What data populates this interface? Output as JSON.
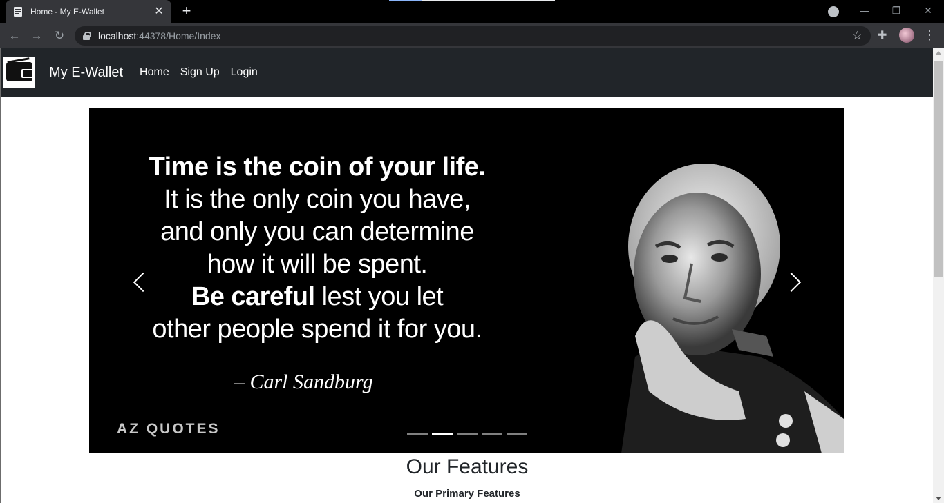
{
  "browser": {
    "tab_title": "Home - My E-Wallet",
    "url_host": "localhost",
    "url_rest": ":44378/Home/Index"
  },
  "navbar": {
    "brand": "My E-Wallet",
    "links": [
      "Home",
      "Sign Up",
      "Login"
    ]
  },
  "carousel": {
    "quote_lines": [
      "Time is the coin of your life.",
      "It is the only coin you have,",
      "and only you can determine",
      "how it will be spent.",
      "Be careful",
      " lest you let",
      "other people spend it for you."
    ],
    "author": "– Carl Sandburg",
    "watermark": "AZ QUOTES",
    "slide_count": 5,
    "active_slide": 2
  },
  "features": {
    "title": "Our Features",
    "subtitle": "Our Primary Features"
  }
}
